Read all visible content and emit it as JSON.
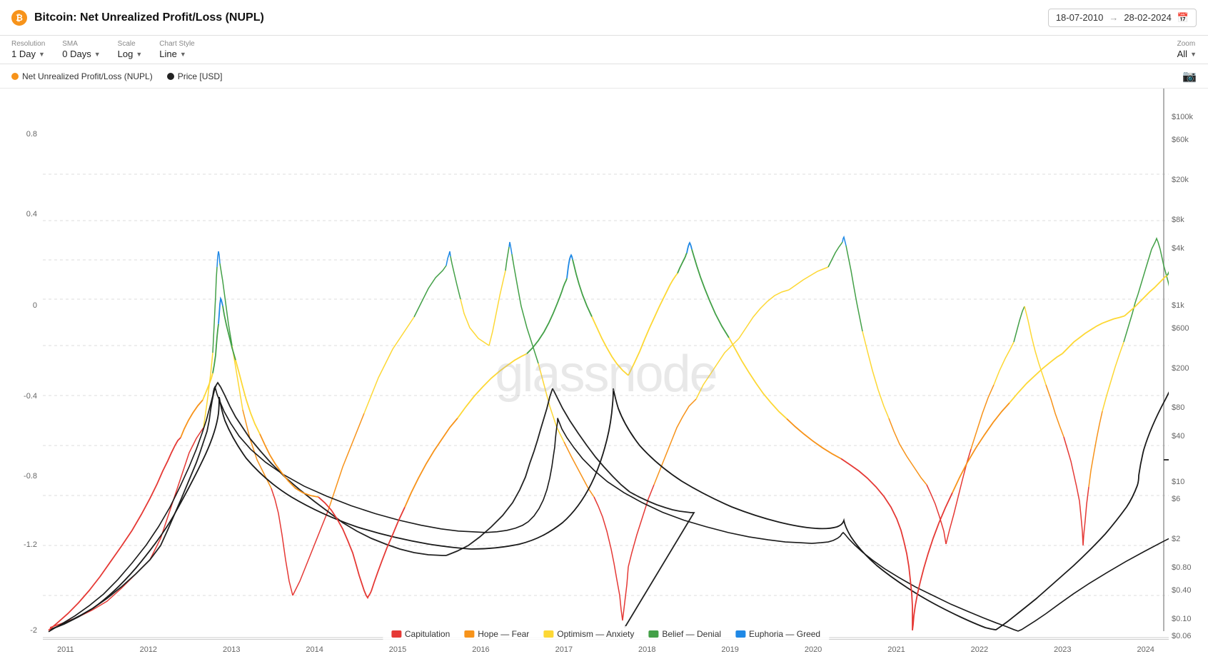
{
  "header": {
    "btc_icon": "₿",
    "title": "Bitcoin: Net Unrealized Profit/Loss (NUPL)",
    "date_start": "18-07-2010",
    "date_arrow": "→",
    "date_end": "28-02-2024"
  },
  "controls": {
    "resolution_label": "Resolution",
    "resolution_value": "1 Day",
    "sma_label": "SMA",
    "sma_value": "0 Days",
    "scale_label": "Scale",
    "scale_value": "Log",
    "chart_style_label": "Chart Style",
    "chart_style_value": "Line",
    "zoom_label": "Zoom",
    "zoom_value": "All"
  },
  "legend": {
    "nupl_label": "Net Unrealized Profit/Loss (NUPL)",
    "nupl_color": "#f7931a",
    "price_label": "Price [USD]",
    "price_color": "#222"
  },
  "bottom_legend": [
    {
      "label": "Capitulation",
      "color": "#e53935"
    },
    {
      "label": "Hope — Fear",
      "color": "#f7931a"
    },
    {
      "label": "Optimism — Anxiety",
      "color": "#fdd835"
    },
    {
      "label": "Belief — Denial",
      "color": "#43a047"
    },
    {
      "label": "Euphoria — Greed",
      "color": "#1e88e5"
    }
  ],
  "y_axis_left": {
    "labels": [
      {
        "value": "0.8",
        "pct": 8
      },
      {
        "value": "0.4",
        "pct": 22
      },
      {
        "value": "0",
        "pct": 38
      },
      {
        "value": "-0.4",
        "pct": 54
      },
      {
        "value": "-0.8",
        "pct": 68
      },
      {
        "value": "-1.2",
        "pct": 80
      },
      {
        "value": "-2",
        "pct": 95
      }
    ]
  },
  "y_axis_right": {
    "labels": [
      {
        "value": "$100k",
        "pct": 5
      },
      {
        "value": "$60k",
        "pct": 9
      },
      {
        "value": "$20k",
        "pct": 16
      },
      {
        "value": "$8k",
        "pct": 23
      },
      {
        "value": "$4k",
        "pct": 28
      },
      {
        "value": "$1k",
        "pct": 38
      },
      {
        "value": "$600",
        "pct": 42
      },
      {
        "value": "$200",
        "pct": 49
      },
      {
        "value": "$80",
        "pct": 56
      },
      {
        "value": "$40",
        "pct": 61
      },
      {
        "value": "$10",
        "pct": 69
      },
      {
        "value": "$6",
        "pct": 72
      },
      {
        "value": "$2",
        "pct": 79
      },
      {
        "value": "$0.80",
        "pct": 84
      },
      {
        "value": "$0.40",
        "pct": 88
      },
      {
        "value": "$0.10",
        "pct": 93
      },
      {
        "value": "$0.06",
        "pct": 96
      }
    ]
  },
  "x_axis": {
    "labels": [
      "2011",
      "2012",
      "2013",
      "2014",
      "2015",
      "2016",
      "2017",
      "2018",
      "2019",
      "2020",
      "2021",
      "2022",
      "2023",
      "2024"
    ]
  },
  "watermark": "glassnode"
}
